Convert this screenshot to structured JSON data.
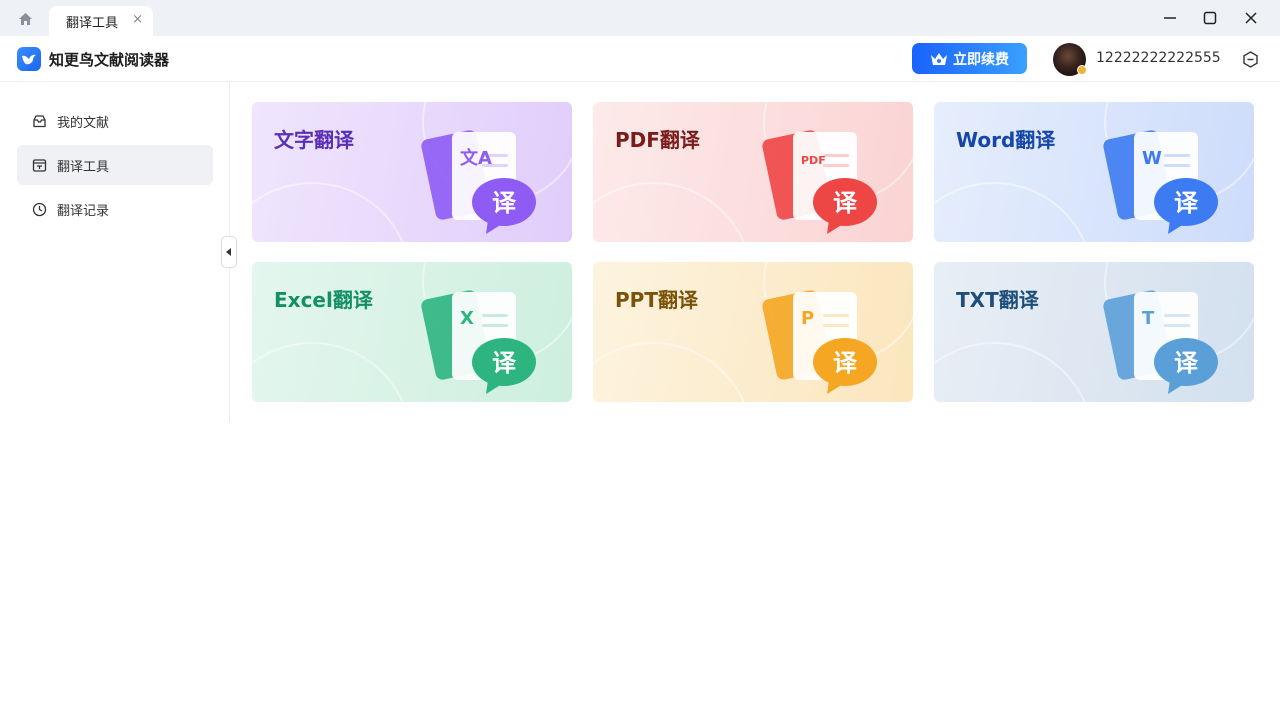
{
  "window": {
    "tab_label": "翻译工具",
    "tab_close": "×"
  },
  "app": {
    "title": "知更鸟文献阅读器",
    "renew_label": "立即续费",
    "username": "12222222222555"
  },
  "sidebar": {
    "items": [
      {
        "label": "我的文献",
        "icon": "library-icon",
        "active": false
      },
      {
        "label": "翻译工具",
        "icon": "translate-tool-icon",
        "active": true
      },
      {
        "label": "翻译记录",
        "icon": "history-clock-icon",
        "active": false
      }
    ]
  },
  "cards": [
    {
      "title": "文字翻译",
      "doc_glyph": "文A",
      "badge": "译",
      "title_color": "#5a2fb5",
      "accent": "#8e5cf5"
    },
    {
      "title": "PDF翻译",
      "doc_glyph": "PDF",
      "badge": "译",
      "title_color": "#7a1c1c",
      "accent": "#ee4545"
    },
    {
      "title": "Word翻译",
      "doc_glyph": "W",
      "badge": "译",
      "title_color": "#1646a8",
      "accent": "#3d7bf2"
    },
    {
      "title": "Excel翻译",
      "doc_glyph": "X",
      "badge": "译",
      "title_color": "#149066",
      "accent": "#2eb57f"
    },
    {
      "title": "PPT翻译",
      "doc_glyph": "P",
      "badge": "译",
      "title_color": "#7a5208",
      "accent": "#f5a623"
    },
    {
      "title": "TXT翻译",
      "doc_glyph": "T",
      "badge": "译",
      "title_color": "#1e4f7a",
      "accent": "#5b9fd8"
    }
  ]
}
